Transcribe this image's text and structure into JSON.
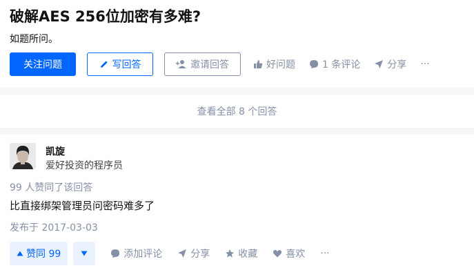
{
  "question": {
    "title": "破解AES 256位加密有多难?",
    "description": "如题所问。",
    "actions": {
      "follow_label": "关注问题",
      "write_label": "写回答",
      "invite_label": "邀请回答",
      "good_question_label": "好问题",
      "comments_label": "1 条评论",
      "share_label": "分享",
      "more_label": "···"
    }
  },
  "view_all": {
    "label": "查看全部 8 个回答"
  },
  "answer": {
    "author": {
      "name": "凯旋",
      "bio": "爱好投资的程序员"
    },
    "vote_summary": "99 人赞同了该回答",
    "content": "比直接绑架管理员问密码难多了",
    "published": "发布于 2017-03-03",
    "actions": {
      "upvote_label": "赞同 99",
      "add_comment_label": "添加评论",
      "share_label": "分享",
      "collect_label": "收藏",
      "like_label": "喜欢",
      "more_label": "···"
    }
  },
  "colors": {
    "accent": "#0066ff",
    "muted": "#8590a6",
    "vote_bg": "#ebf2ff"
  }
}
